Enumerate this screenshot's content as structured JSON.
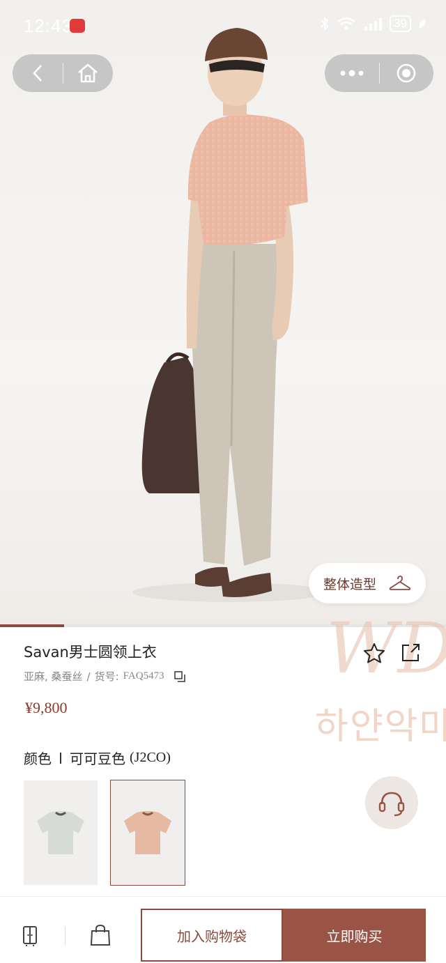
{
  "status": {
    "time": "12:43",
    "battery": "39"
  },
  "product": {
    "name": "Savan男士圆领上衣",
    "meta_material": "亚麻, 桑蚕丝",
    "meta_sep": "/",
    "meta_sku_label": "货号:",
    "meta_sku": "FAQ5473",
    "price": "¥9,800"
  },
  "style_button": {
    "label": "整体造型"
  },
  "color": {
    "label": "颜色",
    "value": "可可豆色",
    "code": "(J2CO)"
  },
  "watermark": {
    "text": "하얀악마",
    "logo": "WD"
  },
  "actions": {
    "add_to_bag": "加入购物袋",
    "buy_now": "立即购买"
  },
  "colors": {
    "accent": "#8a4a3e",
    "buy_bg": "#9a5446"
  },
  "icons": [
    "back-icon",
    "home-icon",
    "more-icon",
    "record-icon",
    "hanger-icon",
    "star-icon",
    "share-icon",
    "copy-icon",
    "headset-icon",
    "wardrobe-icon",
    "bag-icon"
  ]
}
